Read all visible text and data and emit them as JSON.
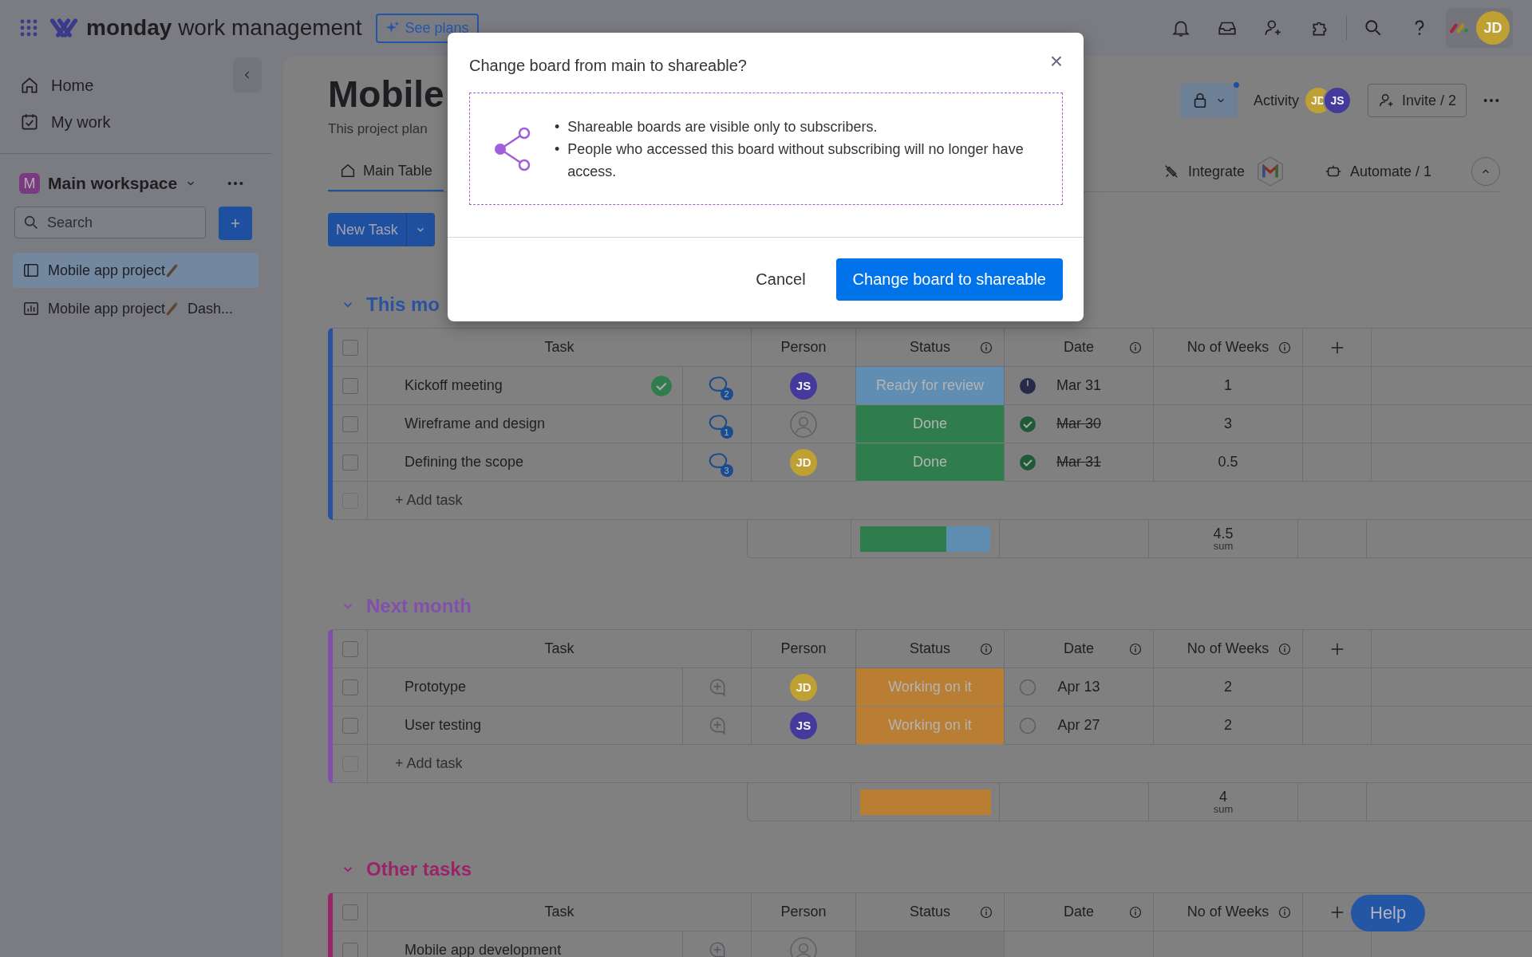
{
  "topbar": {
    "brand_bold": "monday",
    "brand_rest": "work management",
    "see_plans": "See plans",
    "avatar": {
      "initials": "JD",
      "color": "#bfa032"
    }
  },
  "sidebar": {
    "nav": [
      {
        "label": "Home",
        "kind": "home"
      },
      {
        "label": "My work",
        "kind": "mywork"
      }
    ],
    "workspace": {
      "initial": "M",
      "name": "Main workspace"
    },
    "search_placeholder": "Search",
    "boards": [
      {
        "label": "Mobile app project",
        "kind": "table",
        "selected": true
      },
      {
        "label": "Mobile app project",
        "suffix": "Dash...",
        "kind": "dashboard",
        "selected": false
      }
    ]
  },
  "board": {
    "title": "Mobile",
    "description": "This project plan",
    "tabs": [
      {
        "label": "Main Table",
        "selected": true
      }
    ],
    "activity": "Activity",
    "activity_avatars": [
      {
        "initials": "JD",
        "color": "#bfa032"
      },
      {
        "initials": "JS",
        "color": "#443a9b"
      }
    ],
    "invite": "Invite / 2",
    "integrate": "Integrate",
    "automate": "Automate / 1",
    "new_task": "New Task"
  },
  "groups": [
    {
      "title": "This mo",
      "color": "#2a52a0",
      "select_all": false,
      "columns": [
        "Task",
        "Person",
        "Status",
        "Date",
        "No of Weeks"
      ],
      "add_task": {
        "label": "+ Add task",
        "checked": false
      },
      "rows": [
        {
          "checked": false,
          "task": "Kickoff meeting",
          "done": true,
          "updates": "2",
          "person": {
            "initials": "JS",
            "color": "#443a9b"
          },
          "status": {
            "label": "Ready for review",
            "color": "#5f8eb2"
          },
          "date_mark": {
            "kind": "clock"
          },
          "date": "Mar 31",
          "struck": false,
          "weeks": "1"
        },
        {
          "checked": false,
          "task": "Wireframe and design",
          "done": false,
          "updates": "1",
          "status": {
            "label": "Done",
            "color": "#2f7d4c"
          },
          "date_mark": {
            "kind": "check"
          },
          "date": "Mar 30",
          "struck": true,
          "weeks": "3"
        },
        {
          "checked": false,
          "task": "Defining the scope",
          "done": false,
          "updates": "3",
          "person": {
            "initials": "JD",
            "color": "#bfa032"
          },
          "status": {
            "label": "Done",
            "color": "#2f7d4c"
          },
          "date_mark": {
            "kind": "check"
          },
          "date": "Mar 31",
          "struck": true,
          "weeks": "0.5"
        }
      ],
      "summary": {
        "segments": [
          {
            "color": "#2f7d4c",
            "level": 0.66
          },
          {
            "color": "#5f8eb2",
            "level": 0.34
          }
        ],
        "sum": "4.5",
        "sum_label": "sum"
      }
    },
    {
      "title": "Next month",
      "color": "#8250aa",
      "select_all": false,
      "columns": [
        "Task",
        "Person",
        "Status",
        "Date",
        "No of Weeks"
      ],
      "add_task": {
        "label": "+ Add task",
        "checked": false
      },
      "rows": [
        {
          "checked": false,
          "task": "Prototype",
          "done": false,
          "person": {
            "initials": "JD",
            "color": "#bfa032"
          },
          "status": {
            "label": "Working on it",
            "color": "#b97d33"
          },
          "date_mark": {
            "kind": "circle"
          },
          "date": "Apr 13",
          "struck": false,
          "weeks": "2"
        },
        {
          "checked": false,
          "task": "User testing",
          "done": false,
          "person": {
            "initials": "JS",
            "color": "#443a9b"
          },
          "status": {
            "label": "Working on it",
            "color": "#b97d33"
          },
          "date_mark": {
            "kind": "circle"
          },
          "date": "Apr 27",
          "struck": false,
          "weeks": "2"
        }
      ],
      "summary": {
        "segments": [
          {
            "color": "#b97d33",
            "level": 1
          }
        ],
        "sum": "4",
        "sum_label": "sum"
      }
    },
    {
      "title": "Other tasks",
      "color": "#9a2468",
      "select_all": false,
      "columns": [
        "Task",
        "Person",
        "Status",
        "Date",
        "No of Weeks"
      ],
      "rows": [
        {
          "checked": false,
          "task": "Mobile app development",
          "done": false,
          "status": {
            "color": "#7a7a7a"
          }
        }
      ]
    }
  ],
  "modal": {
    "title": "Change board from main to shareable?",
    "close": "×",
    "bullet": "•",
    "bullets": [
      "Shareable boards are visible only to subscribers.",
      "People who accessed this board without subscribing will no longer have access."
    ],
    "cancel": "Cancel",
    "confirm": "Change board to shareable"
  },
  "help": "Help"
}
